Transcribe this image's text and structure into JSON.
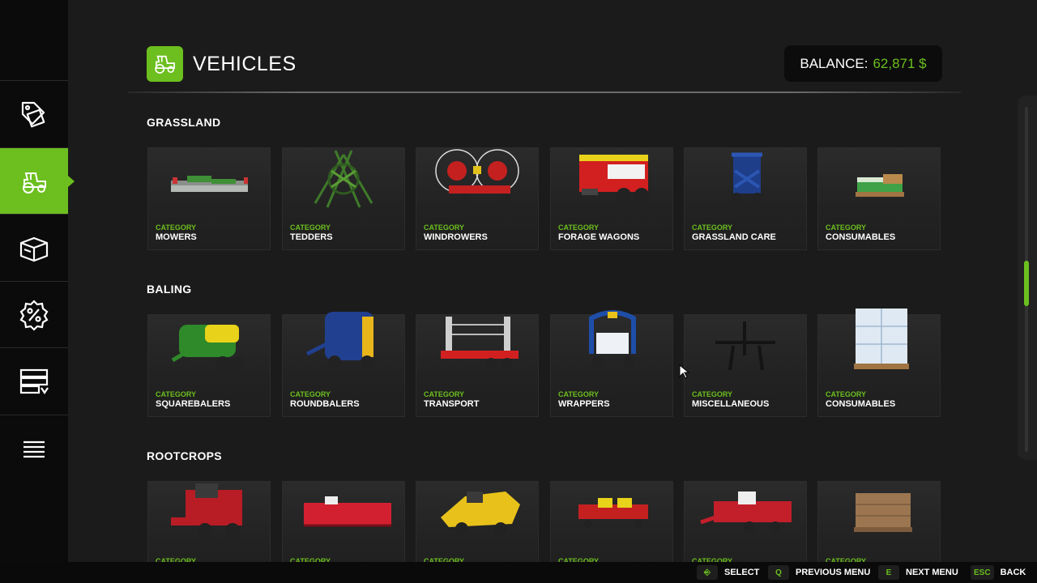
{
  "header": {
    "title": "VEHICLES",
    "balance_label": "BALANCE:",
    "balance_value": "62,871 $"
  },
  "sidebar": {
    "items": [
      {
        "icon": "shop-tag-icon"
      },
      {
        "icon": "tractor-icon",
        "active": true
      },
      {
        "icon": "package-box-icon"
      },
      {
        "icon": "percent-sale-icon"
      },
      {
        "icon": "garage-list-icon"
      },
      {
        "icon": "menu-lines-icon"
      }
    ]
  },
  "sections": [
    {
      "title": "GRASSLAND",
      "cards": [
        {
          "category": "CATEGORY",
          "label": "MOWERS"
        },
        {
          "category": "CATEGORY",
          "label": "TEDDERS"
        },
        {
          "category": "CATEGORY",
          "label": "WINDROWERS"
        },
        {
          "category": "CATEGORY",
          "label": "FORAGE WAGONS"
        },
        {
          "category": "CATEGORY",
          "label": "GRASSLAND CARE"
        },
        {
          "category": "CATEGORY",
          "label": "CONSUMABLES"
        }
      ]
    },
    {
      "title": "BALING",
      "cards": [
        {
          "category": "CATEGORY",
          "label": "SQUAREBALERS"
        },
        {
          "category": "CATEGORY",
          "label": "ROUNDBALERS"
        },
        {
          "category": "CATEGORY",
          "label": "TRANSPORT"
        },
        {
          "category": "CATEGORY",
          "label": "WRAPPERS"
        },
        {
          "category": "CATEGORY",
          "label": "MISCELLANEOUS"
        },
        {
          "category": "CATEGORY",
          "label": "CONSUMABLES"
        }
      ]
    },
    {
      "title": "ROOTCROPS",
      "cards": [
        {
          "category": "CATEGORY",
          "label": ""
        },
        {
          "category": "CATEGORY",
          "label": ""
        },
        {
          "category": "CATEGORY",
          "label": ""
        },
        {
          "category": "CATEGORY",
          "label": ""
        },
        {
          "category": "CATEGORY",
          "label": ""
        },
        {
          "category": "CATEGORY",
          "label": ""
        }
      ]
    }
  ],
  "footer": {
    "hints": [
      {
        "key": "⎆",
        "label": "SELECT"
      },
      {
        "key": "Q",
        "label": "PREVIOUS MENU"
      },
      {
        "key": "E",
        "label": "NEXT MENU"
      },
      {
        "key": "ESC",
        "label": "BACK"
      }
    ]
  },
  "colors": {
    "accent": "#6cbf1f",
    "background": "#1b1b1b",
    "sidebar": "#0b0b0b"
  }
}
